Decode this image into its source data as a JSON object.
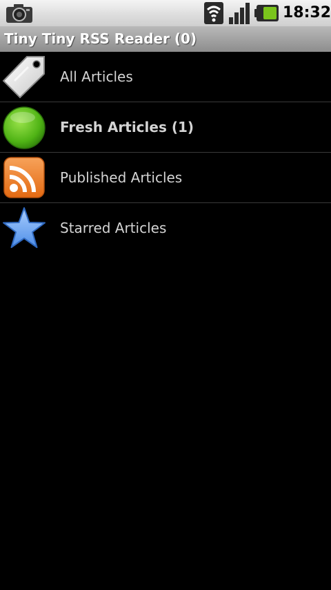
{
  "status_bar": {
    "time": "18:32",
    "icons": [
      "camera-icon",
      "wifi-icon",
      "signal-icon",
      "battery-icon"
    ]
  },
  "title_bar": {
    "title": "Tiny Tiny RSS Reader (0)"
  },
  "feeds": [
    {
      "label": "All Articles",
      "icon": "tag-icon",
      "bold": false
    },
    {
      "label": "Fresh Articles (1)",
      "icon": "green-circle-icon",
      "bold": true
    },
    {
      "label": "Published Articles",
      "icon": "rss-icon",
      "bold": false
    },
    {
      "label": "Starred Articles",
      "icon": "star-icon",
      "bold": false
    }
  ],
  "colors": {
    "background": "#000000",
    "title_bar": "#a0a0a0",
    "item_text": "#d4d4d4",
    "divider": "#3a3a3a",
    "battery_level": "#7ac41c",
    "fresh_green": "#5cc61a",
    "rss_orange": "#f27a1f",
    "star_blue": "#6aa6f8"
  }
}
